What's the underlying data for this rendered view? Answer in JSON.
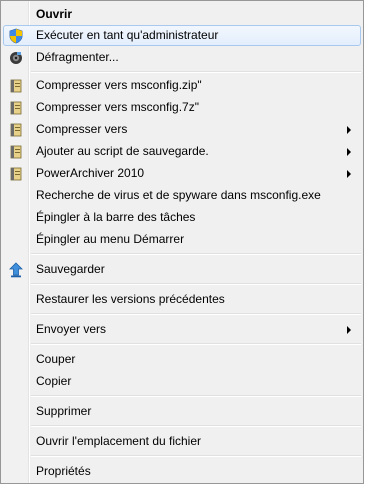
{
  "menu": {
    "items": [
      {
        "label": "Ouvrir"
      },
      {
        "label": "Exécuter en tant qu'administrateur"
      },
      {
        "label": "Défragmenter..."
      },
      {
        "label": "Compresser vers msconfig.zip\""
      },
      {
        "label": "Compresser vers msconfig.7z\""
      },
      {
        "label": "Compresser vers"
      },
      {
        "label": "Ajouter au script de sauvegarde."
      },
      {
        "label": "PowerArchiver 2010"
      },
      {
        "label": "Recherche de virus et de spyware dans msconfig.exe"
      },
      {
        "label": "Épingler à la barre des tâches"
      },
      {
        "label": "Épingler au menu Démarrer"
      },
      {
        "label": "Sauvegarder"
      },
      {
        "label": "Restaurer les versions précédentes"
      },
      {
        "label": "Envoyer vers"
      },
      {
        "label": "Couper"
      },
      {
        "label": "Copier"
      },
      {
        "label": "Supprimer"
      },
      {
        "label": "Ouvrir l'emplacement du fichier"
      },
      {
        "label": "Propriétés"
      }
    ]
  },
  "icons": {
    "shield": "uac-shield-icon",
    "defrag": "defrag-icon",
    "archive": "powerarchiver-icon",
    "backup": "backup-arrow-icon"
  },
  "colors": {
    "hover_border": "#a8c8ee",
    "hover_bg": "#e3eefc",
    "menu_border": "#979797"
  }
}
